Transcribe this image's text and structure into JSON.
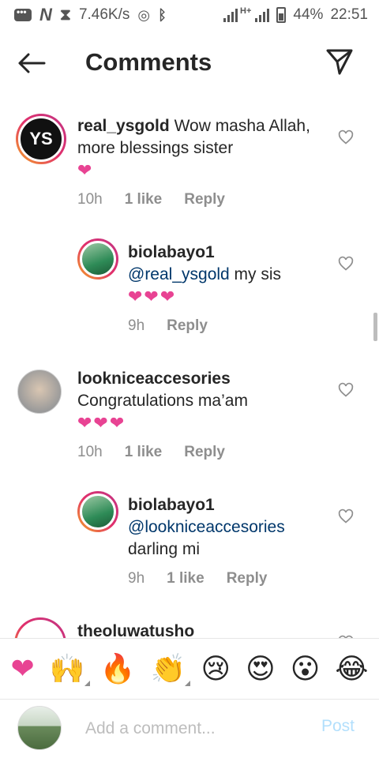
{
  "status_bar": {
    "speed": "7.46K/s",
    "network": "H+",
    "battery": "44%",
    "time": "22:51"
  },
  "header": {
    "title": "Comments",
    "back_icon": "arrow-left-icon",
    "send_icon": "paper-plane-icon"
  },
  "comments": [
    {
      "username": "real_ysgold",
      "avatar_text": "YS",
      "text": " Wow masha Allah, more blessings sister",
      "hearts": "❤",
      "time": "10h",
      "likes": "1 like",
      "reply": "Reply"
    },
    {
      "username": "biolabayo1",
      "mention": "@real_ysgold",
      "text": " my sis",
      "hearts": "❤❤❤",
      "time": "9h",
      "reply": "Reply"
    },
    {
      "username": "lookniceaccesories",
      "text": "Congratulations ma’am",
      "hearts": "❤❤❤",
      "time": "10h",
      "likes": "1 like",
      "reply": "Reply"
    },
    {
      "username": "biolabayo1",
      "mention": "@lookniceaccesories",
      "text": "darling mi",
      "time": "9h",
      "likes": "1 like",
      "reply": "Reply"
    },
    {
      "username": "theoluwatusho"
    }
  ],
  "emoji_bar": [
    "❤",
    "🙌",
    "🔥",
    "👏",
    "😢",
    "😍",
    "😮",
    "😂"
  ],
  "composer": {
    "placeholder": "Add a comment...",
    "post_label": "Post"
  },
  "colors": {
    "accent_post": "#b2dffc",
    "mention": "#00376b",
    "heart": "#e84393",
    "meta": "#8e8e8e"
  }
}
